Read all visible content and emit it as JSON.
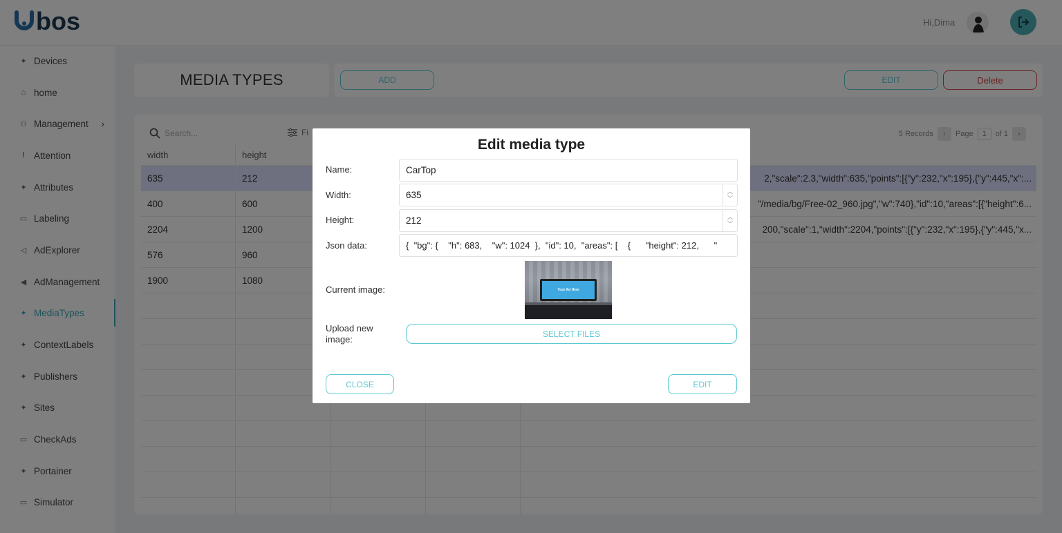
{
  "header": {
    "greeting": "Hi,Dima",
    "colors": {
      "accent": "#4aaeb6",
      "logo": "#1f3a52",
      "logo_u": "#2b6ea8"
    }
  },
  "sidebar": {
    "items": [
      {
        "label": "Devices",
        "icon": "sparkle-icon"
      },
      {
        "label": "home",
        "icon": "home-icon"
      },
      {
        "label": "Management",
        "icon": "users-icon"
      },
      {
        "label": "Attention",
        "icon": "exclamation-icon"
      },
      {
        "label": "Attributes",
        "icon": "sparkle-icon"
      },
      {
        "label": "Labeling",
        "icon": "tag-icon"
      },
      {
        "label": "AdExplorer",
        "icon": "megaphone-icon"
      },
      {
        "label": "AdManagement",
        "icon": "megaphone-icon"
      },
      {
        "label": "MediaTypes",
        "icon": "sparkle-icon",
        "active": true
      },
      {
        "label": "ContextLabels",
        "icon": "sparkle-icon"
      },
      {
        "label": "Publishers",
        "icon": "sparkle-icon"
      },
      {
        "label": "Sites",
        "icon": "sparkle-icon"
      },
      {
        "label": "CheckAds",
        "icon": "tag-icon"
      },
      {
        "label": "Portainer",
        "icon": "sparkle-icon"
      },
      {
        "label": "Simulator",
        "icon": "tag-icon"
      }
    ]
  },
  "page": {
    "title": "MEDIA TYPES",
    "add_label": "ADD",
    "edit_label": "EDIT",
    "delete_label": "Delete"
  },
  "table": {
    "search_placeholder": "Search...",
    "filters_label": "Fi",
    "records": "5 Records",
    "page_label": "Page",
    "page_number": "1",
    "page_of": "of 1",
    "columns": [
      "width",
      "height"
    ],
    "rows": [
      {
        "width": "635",
        "height": "212",
        "json": "2,\"scale\":2.3,\"width\":635,\"points\":[{\"y\":232,\"x\":195},{\"y\":445,\"x\":...",
        "selected": true
      },
      {
        "width": "400",
        "height": "600",
        "json": "\"/media/bg/Free-02_960.jpg\",\"w\":740},\"id\":10,\"areas\":[{\"height\":6..."
      },
      {
        "width": "2204",
        "height": "1200",
        "json": "200,\"scale\":1,\"width\":2204,\"points\":[{\"y\":232,\"x\":195},{\"y\":445,\"x..."
      },
      {
        "width": "576",
        "height": "960",
        "json": ""
      },
      {
        "width": "1900",
        "height": "1080",
        "json": ""
      }
    ]
  },
  "modal": {
    "title": "Edit media type",
    "name_label": "Name:",
    "name_value": "CarTop",
    "width_label": "Width:",
    "width_value": "635",
    "height_label": "Height:",
    "height_value": "212",
    "json_label": "Json data:",
    "json_value": "{  \"bg\": {    \"h\": 683,    \"w\": 1024  },  \"id\": 10,  \"areas\": [    {      \"height\": 212,      \"",
    "current_image_label": "Current image:",
    "thumb_text": "Your Ad Here",
    "upload_label": "Upload new image:",
    "select_files_label": "SELECT FILES",
    "close_label": "CLOSE",
    "edit_label": "EDIT"
  }
}
